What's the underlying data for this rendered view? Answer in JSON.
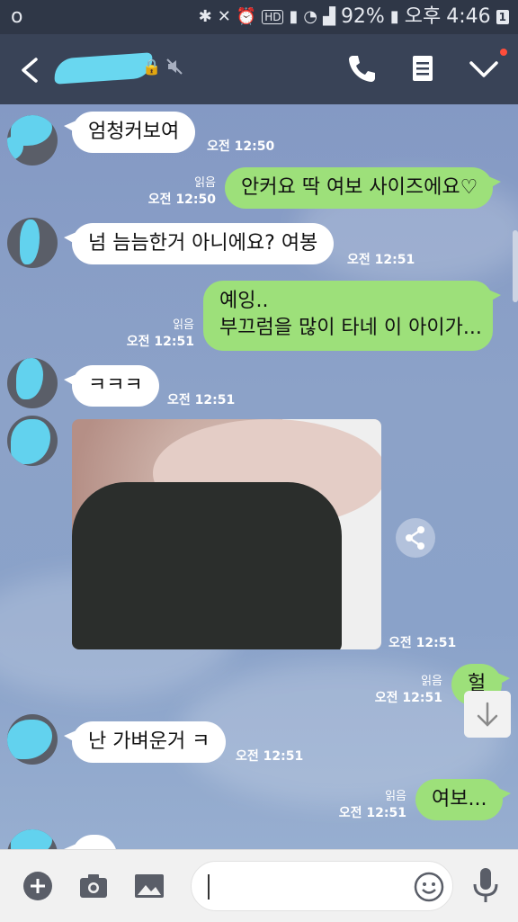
{
  "status_bar": {
    "left_icon": "o",
    "battery_percent": "92%",
    "ampm": "오후",
    "time": "4:46",
    "hd": "HD",
    "notif_count": "1"
  },
  "header": {
    "lock_icon": "lock-icon",
    "mute_icon": "mute-icon"
  },
  "messages": [
    {
      "text": "엄청커보여",
      "time": "오전 12:50"
    },
    {
      "text": "안커요 딱 여보 사이즈에요♡",
      "read": "읽음",
      "time": "오전 12:50"
    },
    {
      "text": "넘 늠늠한거 아니에요? 여봉",
      "time": "오전 12:51"
    },
    {
      "line1": "예잉..",
      "line2": "부끄럼을 많이 타네 이 아이가...",
      "read": "읽음",
      "time": "오전 12:51"
    },
    {
      "text": "ㅋㅋㅋ",
      "time": "오전 12:51"
    },
    {
      "image": "photo",
      "time": "오전 12:51"
    },
    {
      "text": "헐",
      "read": "읽음",
      "time": "오전 12:51"
    },
    {
      "text": "난 가벼운거 ㅋ",
      "time": "오전 12:51"
    },
    {
      "text": "여보...",
      "read": "읽음",
      "time": "오전 12:51"
    }
  ]
}
